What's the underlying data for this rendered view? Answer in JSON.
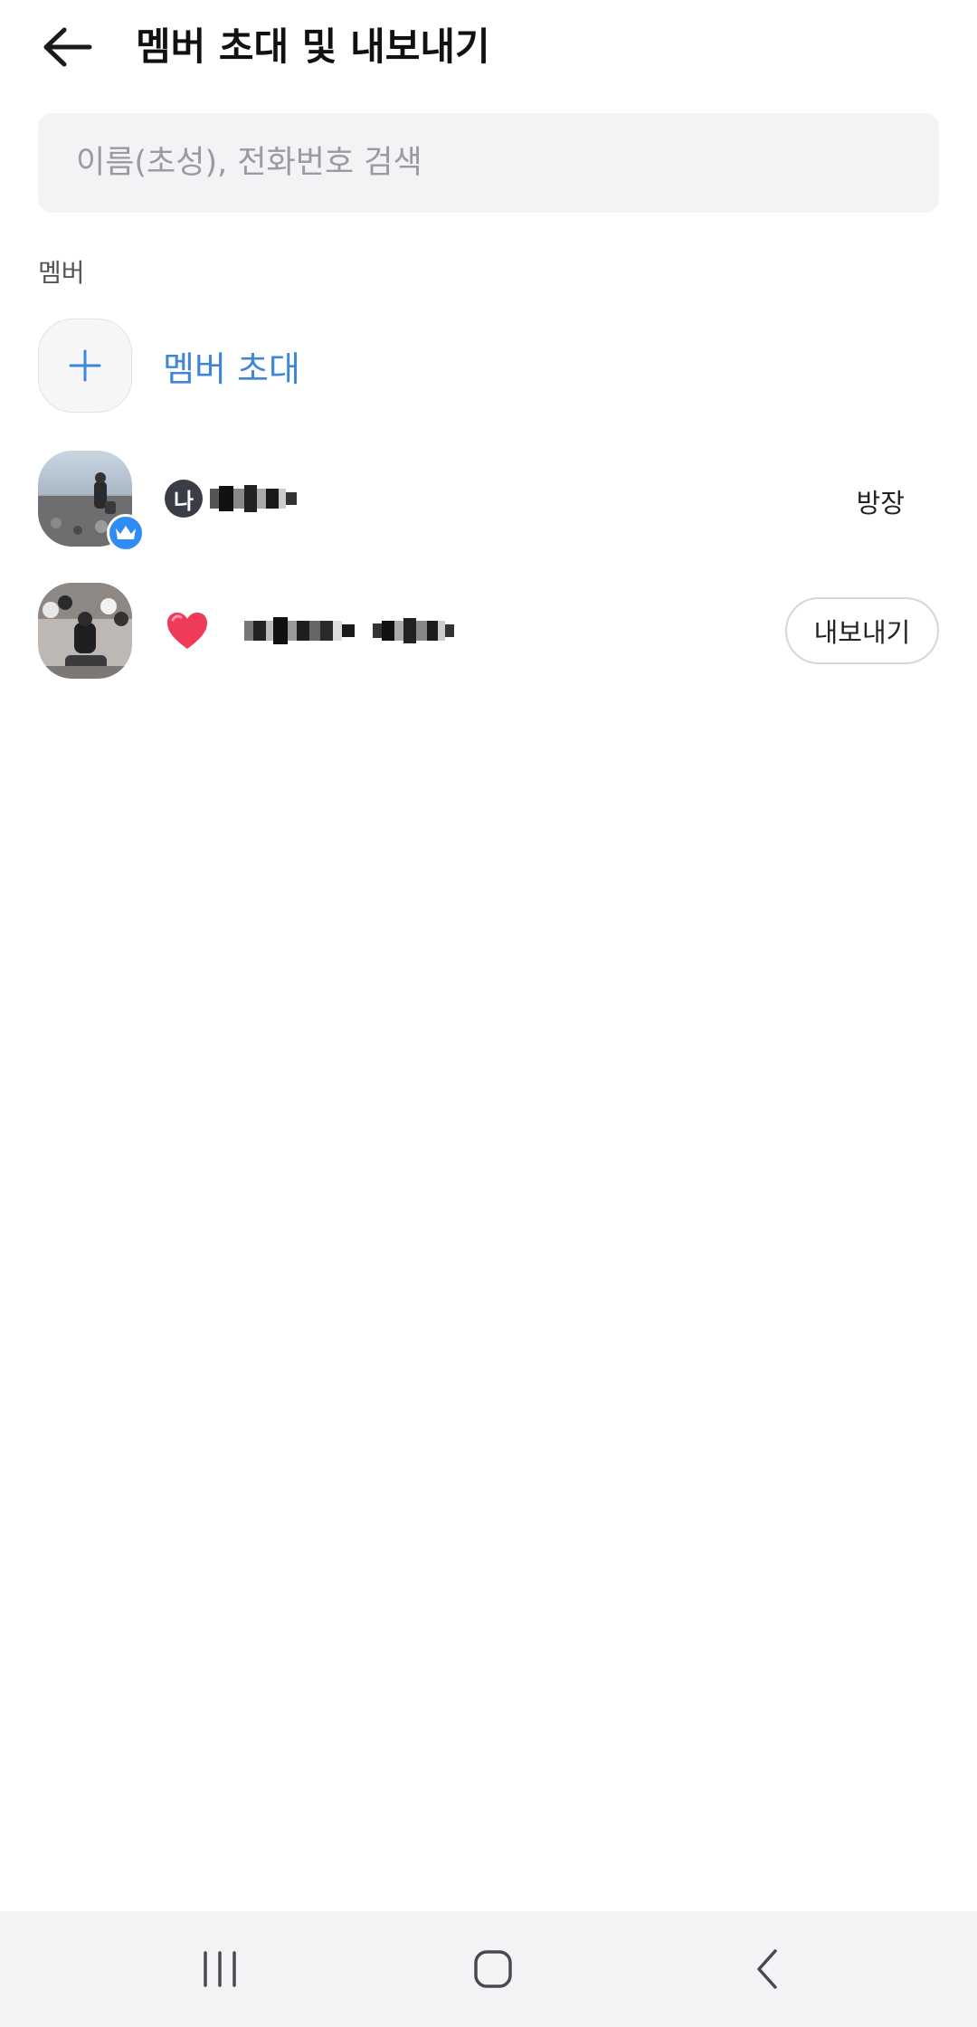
{
  "header": {
    "title": "멤버 초대 및 내보내기",
    "back_icon": "arrow-left-icon"
  },
  "search": {
    "placeholder": "이름(초성), 전화번호 검색"
  },
  "section": {
    "label": "멤버"
  },
  "invite": {
    "label": "멤버 초대",
    "icon": "plus-icon"
  },
  "members": [
    {
      "me_badge": "나",
      "role_label": "방장",
      "is_owner": true,
      "name_redacted": true
    },
    {
      "emoji": "heart-icon",
      "action_label": "내보내기",
      "name_redacted": true
    }
  ],
  "navbar": {
    "recent_icon": "recent-apps-icon",
    "home_icon": "home-icon",
    "back_icon": "back-chevron-icon"
  },
  "colors": {
    "accent": "#3f87d6",
    "crown_badge": "#2f8cf5",
    "search_bg": "#f3f3f5",
    "navbar_bg": "#f4f4f6"
  }
}
